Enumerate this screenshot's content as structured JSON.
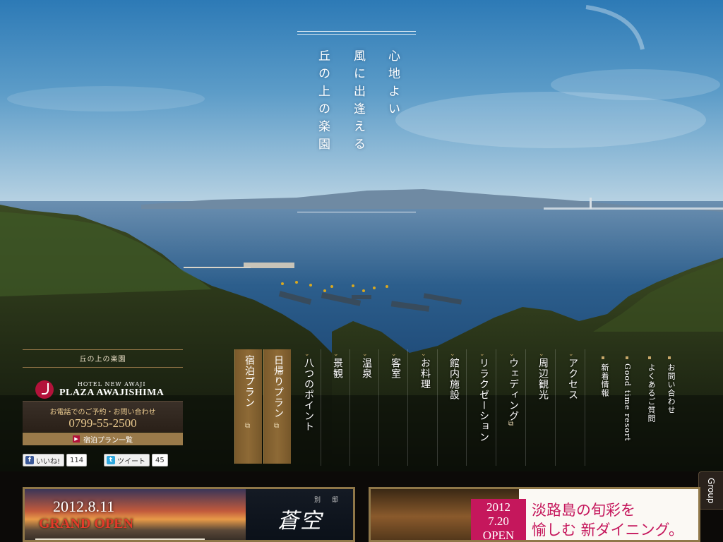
{
  "tagline": {
    "col1": "心地よい",
    "col2": "風に出逢える",
    "col3": "丘の上の楽園"
  },
  "logo": {
    "caption": "丘の上の楽園",
    "small": "HOTEL NEW AWAJI",
    "name": "PLAZA AWAJISHIMA"
  },
  "contact": {
    "label": "お電話でのご予約・お問い合わせ",
    "phone": "0799-55-2500",
    "plans_link": "宿泊プラン一覧"
  },
  "social": {
    "like_label": "いいね!",
    "like_count": "114",
    "tweet_label": "ツイート",
    "tweet_count": "45"
  },
  "plan_tabs": [
    {
      "label": "宿泊プラン"
    },
    {
      "label": "日帰りプラン"
    }
  ],
  "nav": [
    {
      "label": "八つのポイント"
    },
    {
      "label": "景観"
    },
    {
      "label": "温泉"
    },
    {
      "label": "客室"
    },
    {
      "label": "お料理"
    },
    {
      "label": "館内施設"
    },
    {
      "label": "リラクゼーション"
    },
    {
      "label": "ウェディング"
    },
    {
      "label": "周辺観光"
    },
    {
      "label": "アクセス"
    }
  ],
  "side_links": [
    {
      "label": "新着情報"
    },
    {
      "label": "Good time resort"
    },
    {
      "label": "よくあるご質問"
    },
    {
      "label": "お問い合わせ"
    }
  ],
  "group_tab": "Group",
  "banner1": {
    "date": "2012.8.11",
    "open": "GRAND OPEN",
    "sub1": "別",
    "sub2": "邸",
    "name": "蒼空"
  },
  "banner2": {
    "ribbon_date1": "2012",
    "ribbon_date2": "7.20",
    "ribbon_open": "OPEN",
    "headline1": "淡路島の旬彩を",
    "headline2": "愉しむ 新ダイニング。"
  },
  "colors": {
    "accent_gold": "#9a7a4a",
    "brand_red": "#b3123a",
    "banner_pink": "#c5175c"
  }
}
